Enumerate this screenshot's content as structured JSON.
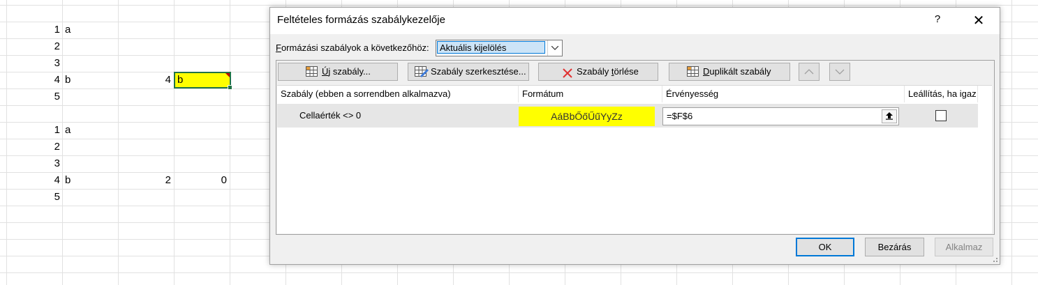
{
  "sheet": {
    "block1": {
      "rows": [
        {
          "n": "1",
          "a": "a"
        },
        {
          "n": "2",
          "a": ""
        },
        {
          "n": "3",
          "a": ""
        },
        {
          "n": "4",
          "a": "b",
          "c": "4",
          "d": "b"
        },
        {
          "n": "5",
          "a": ""
        }
      ]
    },
    "block2": {
      "rows": [
        {
          "n": "1",
          "a": "a"
        },
        {
          "n": "2",
          "a": ""
        },
        {
          "n": "3",
          "a": ""
        },
        {
          "n": "4",
          "a": "b",
          "c": "2",
          "d": "0"
        },
        {
          "n": "5",
          "a": ""
        }
      ]
    },
    "highlight_color": "#ffff00",
    "selection_color": "#217346"
  },
  "dialog": {
    "title": "Feltételes formázás szabálykezelője",
    "help": "?",
    "close": "✕",
    "show_label_accel": "F",
    "show_label_rest": "ormázási szabályok a következőhöz:",
    "scope_value": "Aktuális kijelölés",
    "toolbar": {
      "new_rule_accel": "Ú",
      "new_rule_rest": "j szabály...",
      "edit_rule": "Szabály szerkesztése...",
      "delete_rule_pre": "Szabály ",
      "delete_rule_accel": "t",
      "delete_rule_post": "örlése",
      "duplicate_accel": "D",
      "duplicate_rest": "uplikált szabály",
      "move_up_icon": "chevron-up-icon",
      "move_down_icon": "chevron-down-icon"
    },
    "columns": {
      "rule": "Szabály (ebben a sorrendben alkalmazva)",
      "format": "Formátum",
      "applies_to": "Érvényesség",
      "stop_if_true": "Leállítás, ha igaz"
    },
    "rules": [
      {
        "rule": "Cellaérték <> 0",
        "preview": "AáBbŐőŰűYyZz",
        "preview_fill": "#ffff00",
        "applies_to": "=$F$6",
        "stop_if_true": false
      }
    ],
    "buttons": {
      "ok": "OK",
      "close": "Bezárás",
      "apply": "Alkalmaz"
    }
  }
}
